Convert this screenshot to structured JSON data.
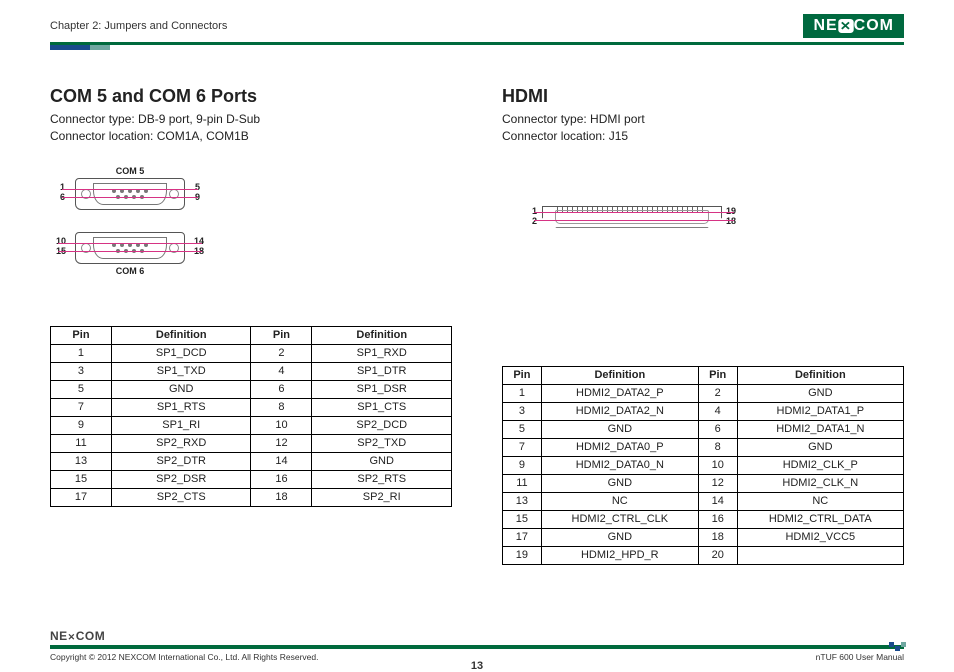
{
  "header": {
    "chapter": "Chapter 2: Jumpers and Connectors",
    "brand": "NEXCOM"
  },
  "left": {
    "title": "COM 5 and COM 6 Ports",
    "conn_type": "Connector type: DB-9 port, 9-pin D-Sub",
    "conn_loc": "Connector location: COM1A, COM1B",
    "diag_top_label": "COM 5",
    "diag_bot_label": "COM 6",
    "top_pins": {
      "tl": "1",
      "bl": "6",
      "tr": "5",
      "br": "9"
    },
    "bot_pins": {
      "tl": "10",
      "bl": "15",
      "tr": "14",
      "br": "18"
    },
    "th1": "Pin",
    "th2": "Definition",
    "th3": "Pin",
    "th4": "Definition",
    "rows": [
      {
        "p1": "1",
        "d1": "SP1_DCD",
        "p2": "2",
        "d2": "SP1_RXD"
      },
      {
        "p1": "3",
        "d1": "SP1_TXD",
        "p2": "4",
        "d2": "SP1_DTR"
      },
      {
        "p1": "5",
        "d1": "GND",
        "p2": "6",
        "d2": "SP1_DSR"
      },
      {
        "p1": "7",
        "d1": "SP1_RTS",
        "p2": "8",
        "d2": "SP1_CTS"
      },
      {
        "p1": "9",
        "d1": "SP1_RI",
        "p2": "10",
        "d2": "SP2_DCD"
      },
      {
        "p1": "11",
        "d1": "SP2_RXD",
        "p2": "12",
        "d2": "SP2_TXD"
      },
      {
        "p1": "13",
        "d1": "SP2_DTR",
        "p2": "14",
        "d2": "GND"
      },
      {
        "p1": "15",
        "d1": "SP2_DSR",
        "p2": "16",
        "d2": "SP2_RTS"
      },
      {
        "p1": "17",
        "d1": "SP2_CTS",
        "p2": "18",
        "d2": "SP2_RI"
      }
    ]
  },
  "right": {
    "title": "HDMI",
    "conn_type": "Connector type: HDMI port",
    "conn_loc": "Connector location: J15",
    "pins": {
      "tl": "1",
      "bl": "2",
      "tr": "19",
      "br": "18"
    },
    "th1": "Pin",
    "th2": "Definition",
    "th3": "Pin",
    "th4": "Definition",
    "rows": [
      {
        "p1": "1",
        "d1": "HDMI2_DATA2_P",
        "p2": "2",
        "d2": "GND"
      },
      {
        "p1": "3",
        "d1": "HDMI2_DATA2_N",
        "p2": "4",
        "d2": "HDMI2_DATA1_P"
      },
      {
        "p1": "5",
        "d1": "GND",
        "p2": "6",
        "d2": "HDMI2_DATA1_N"
      },
      {
        "p1": "7",
        "d1": "HDMI2_DATA0_P",
        "p2": "8",
        "d2": "GND"
      },
      {
        "p1": "9",
        "d1": "HDMI2_DATA0_N",
        "p2": "10",
        "d2": "HDMI2_CLK_P"
      },
      {
        "p1": "11",
        "d1": "GND",
        "p2": "12",
        "d2": "HDMI2_CLK_N"
      },
      {
        "p1": "13",
        "d1": "NC",
        "p2": "14",
        "d2": "NC"
      },
      {
        "p1": "15",
        "d1": "HDMI2_CTRL_CLK",
        "p2": "16",
        "d2": "HDMI2_CTRL_DATA"
      },
      {
        "p1": "17",
        "d1": "GND",
        "p2": "18",
        "d2": "HDMI2_VCC5"
      },
      {
        "p1": "19",
        "d1": "HDMI2_HPD_R",
        "p2": "20",
        "d2": ""
      }
    ]
  },
  "footer": {
    "copyright": "Copyright © 2012 NEXCOM International Co., Ltd. All Rights Reserved.",
    "page": "13",
    "manual": "nTUF 600 User Manual",
    "mini": "NEXCOM"
  }
}
